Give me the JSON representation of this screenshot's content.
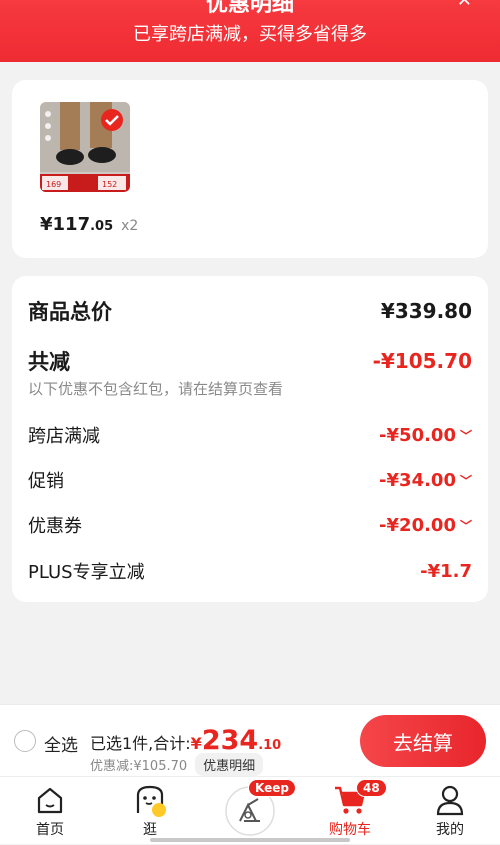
{
  "banner": {
    "title": "优惠明细",
    "subtitle": "已享跨店满减，买得多省得多",
    "close_icon": "close-icon"
  },
  "product": {
    "price_int": "¥117",
    "price_dec": ".05",
    "quantity": "x2",
    "thumb_tags": [
      "169",
      "152"
    ]
  },
  "summary": {
    "total_label": "商品总价",
    "total_value": "¥339.80",
    "discount_label": "共减",
    "discount_value": "-¥105.70",
    "note": "以下优惠不包含红包，请在结算页查看",
    "items": [
      {
        "label": "跨店满减",
        "value": "-¥50.00",
        "expandable": true
      },
      {
        "label": "促销",
        "value": "-¥34.00",
        "expandable": true
      },
      {
        "label": "优惠券",
        "value": "-¥20.00",
        "expandable": true
      },
      {
        "label": "PLUS专享立减",
        "value": "-¥1.7",
        "expandable": false
      }
    ]
  },
  "checkout": {
    "select_all": "全选",
    "selected_text": "已选1件,合计:",
    "currency": "¥",
    "amount_int": "234",
    "amount_dec": ".10",
    "saved": "优惠减:¥105.70",
    "detail_chip": "优惠明细",
    "button": "去结算"
  },
  "tabs": [
    {
      "label": "首页",
      "icon": "home-icon"
    },
    {
      "label": "逛",
      "icon": "browse-face-icon"
    },
    {
      "label": "",
      "icon": "keep-promo-icon",
      "badge": "Keep"
    },
    {
      "label": "购物车",
      "icon": "cart-icon",
      "badge": "48",
      "active": true
    },
    {
      "label": "我的",
      "icon": "profile-icon"
    }
  ],
  "colors": {
    "brand": "#e8261f",
    "banner": "#f63a3f"
  }
}
